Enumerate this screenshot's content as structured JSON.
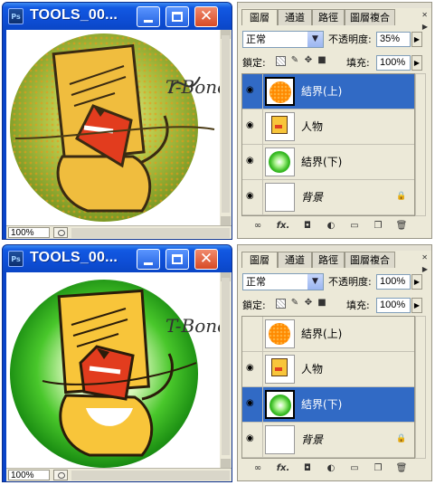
{
  "screenshots": [
    {
      "window": {
        "title": "TOOLS_00...",
        "app_icon": "Ps",
        "zoom": "100%",
        "artwork": "orange-overlay",
        "signature": "T-Bone"
      },
      "panel": {
        "tabs": [
          "圖層",
          "通道",
          "路徑",
          "圖層複合"
        ],
        "blend_mode": "正常",
        "opacity_label": "不透明度:",
        "opacity": "35%",
        "lock_label": "鎖定:",
        "fill_label": "填充:",
        "fill": "100%",
        "layers": [
          {
            "name": "結界(上)",
            "visible": true,
            "selected": true,
            "thumb": "orange-circle",
            "italic": false
          },
          {
            "name": "人物",
            "visible": true,
            "selected": false,
            "thumb": "tiger",
            "italic": false
          },
          {
            "name": "結界(下)",
            "visible": true,
            "selected": false,
            "thumb": "green-circle",
            "italic": false
          },
          {
            "name": "背景",
            "visible": true,
            "selected": false,
            "thumb": "white",
            "italic": true,
            "locked": true
          }
        ]
      }
    },
    {
      "window": {
        "title": "TOOLS_00...",
        "app_icon": "Ps",
        "zoom": "100%",
        "artwork": "green-circle",
        "signature": "T-Bone"
      },
      "panel": {
        "tabs": [
          "圖層",
          "通道",
          "路徑",
          "圖層複合"
        ],
        "blend_mode": "正常",
        "opacity_label": "不透明度:",
        "opacity": "100%",
        "lock_label": "鎖定:",
        "fill_label": "填充:",
        "fill": "100%",
        "layers": [
          {
            "name": "結界(上)",
            "visible": false,
            "selected": false,
            "thumb": "orange-circle",
            "italic": false
          },
          {
            "name": "人物",
            "visible": true,
            "selected": false,
            "thumb": "tiger",
            "italic": false
          },
          {
            "name": "結界(下)",
            "visible": true,
            "selected": true,
            "thumb": "green-circle",
            "italic": false
          },
          {
            "name": "背景",
            "visible": true,
            "selected": false,
            "thumb": "white",
            "italic": true,
            "locked": true
          }
        ]
      }
    }
  ],
  "colors": {
    "xp_title_blue": "#0e4ed6",
    "selection_blue": "#316ac5",
    "panel_bg": "#ece9d8",
    "close_red": "#d74a25",
    "tiger_yellow": "#f8c53a",
    "orange_overlay": "#ff8a00",
    "green_circle": "#2eaa1e"
  },
  "icons": {
    "window": [
      "photoshop-doc-icon",
      "minimize-icon",
      "maximize-icon",
      "close-icon"
    ],
    "panel_bottom": [
      "link-layers-icon",
      "layer-style-fx-icon",
      "layer-mask-icon",
      "adjustment-layer-icon",
      "new-group-icon",
      "new-layer-icon",
      "trash-icon"
    ],
    "lock": [
      "lock-transparent-icon",
      "lock-paint-icon",
      "lock-move-icon",
      "lock-all-icon"
    ]
  }
}
